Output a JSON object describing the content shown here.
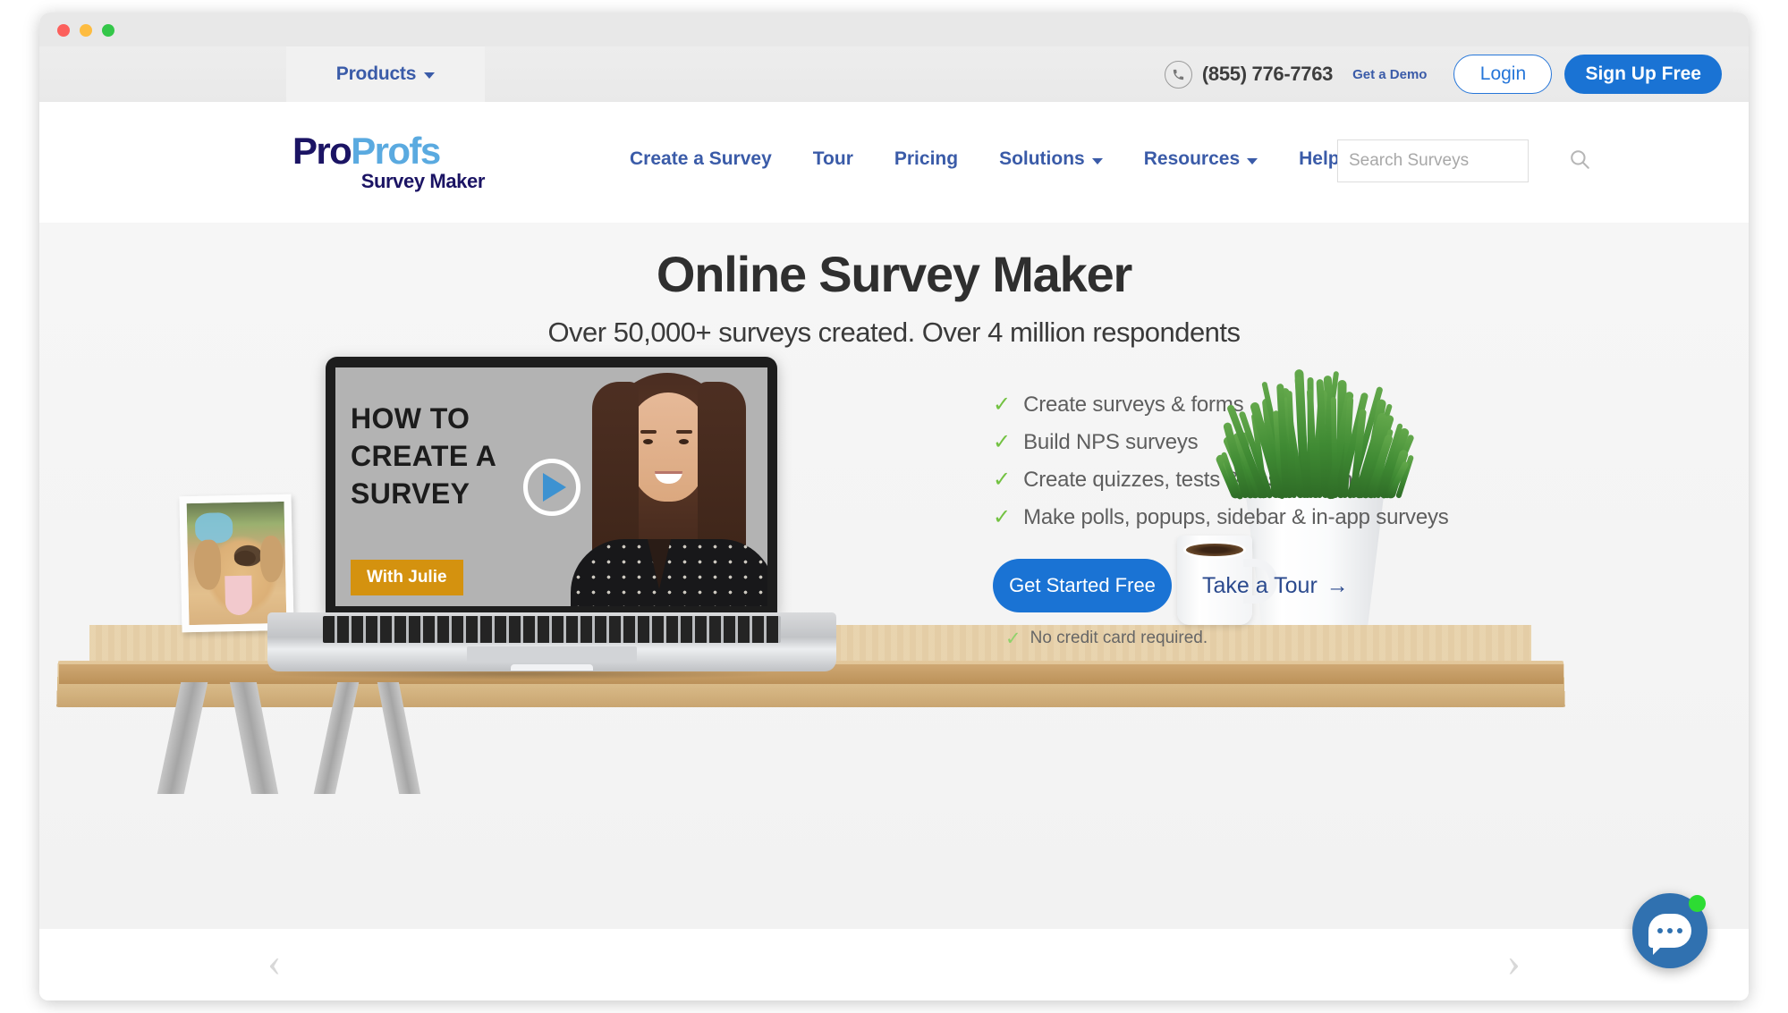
{
  "window": {
    "traffic_lights": [
      "close",
      "minimize",
      "maximize"
    ]
  },
  "utility_bar": {
    "products_label": "Products",
    "phone": "(855) 776-7763",
    "demo_link": "Get a Demo",
    "login_label": "Login",
    "signup_label": "Sign Up Free",
    "phone_icon": "phone-icon",
    "caret_icon": "chevron-down-icon"
  },
  "logo": {
    "part1": "Pro",
    "part2": "Profs",
    "subtitle": "Survey Maker",
    "color_part1": "#1b1464",
    "color_part2": "#5aaae0"
  },
  "nav": {
    "items": [
      {
        "label": "Create a Survey",
        "has_caret": false
      },
      {
        "label": "Tour",
        "has_caret": false
      },
      {
        "label": "Pricing",
        "has_caret": false
      },
      {
        "label": "Solutions",
        "has_caret": true
      },
      {
        "label": "Resources",
        "has_caret": true
      },
      {
        "label": "Help",
        "has_caret": false
      }
    ],
    "link_color": "#3a5ba8"
  },
  "search": {
    "placeholder": "Search Surveys",
    "value": "",
    "icon": "search-icon"
  },
  "hero": {
    "title": "Online Survey Maker",
    "subtitle": "Over 50,000+ surveys created. Over 4 million respondents"
  },
  "video": {
    "line1": "HOW TO",
    "line2": "CREATE A",
    "line3": "SURVEY",
    "badge": "With Julie",
    "badge_color": "#d4920f",
    "play_icon": "play-icon"
  },
  "features": {
    "items": [
      "Create surveys & forms",
      "Build NPS surveys",
      "Create quizzes, tests & assessments",
      "Make polls, popups, sidebar & in-app surveys"
    ],
    "check_icon": "check-icon",
    "check_color": "#73c242"
  },
  "cta": {
    "primary_label": "Get Started Free",
    "primary_color": "#1a73d4",
    "secondary_label": "Take a Tour",
    "secondary_arrow": "→",
    "disclaimer": "No credit card required."
  },
  "carousel": {
    "prev": "‹",
    "next": "›"
  },
  "chat": {
    "icon": "chat-bubble-icon",
    "status": "online",
    "status_color": "#2ddc33",
    "bubble_color": "#3071b0"
  }
}
